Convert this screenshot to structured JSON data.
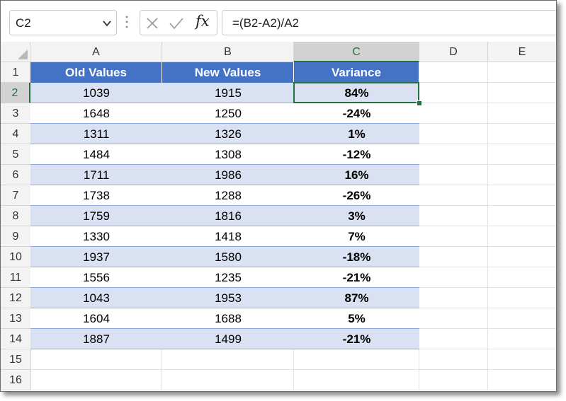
{
  "formula_bar": {
    "name_box": "C2",
    "formula": "=(B2-A2)/A2",
    "fx_label": "fx",
    "icons": [
      "chevron-down-icon",
      "grip-icon",
      "cancel-icon",
      "enter-icon",
      "function-icon"
    ]
  },
  "columns": [
    "A",
    "B",
    "C",
    "D",
    "E"
  ],
  "selected_column": "C",
  "selected_row": "2",
  "rows": [
    "1",
    "2",
    "3",
    "4",
    "5",
    "6",
    "7",
    "8",
    "9",
    "10",
    "11",
    "12",
    "13",
    "14",
    "15",
    "16"
  ],
  "table": {
    "headers": [
      "Old Values",
      "New Values",
      "Variance"
    ],
    "data": [
      [
        "1039",
        "1915",
        "84%"
      ],
      [
        "1648",
        "1250",
        "-24%"
      ],
      [
        "1311",
        "1326",
        "1%"
      ],
      [
        "1484",
        "1308",
        "-12%"
      ],
      [
        "1711",
        "1986",
        "16%"
      ],
      [
        "1738",
        "1288",
        "-26%"
      ],
      [
        "1759",
        "1816",
        "3%"
      ],
      [
        "1330",
        "1418",
        "7%"
      ],
      [
        "1937",
        "1580",
        "-18%"
      ],
      [
        "1556",
        "1235",
        "-21%"
      ],
      [
        "1043",
        "1953",
        "87%"
      ],
      [
        "1604",
        "1688",
        "5%"
      ],
      [
        "1887",
        "1499",
        "-21%"
      ]
    ]
  },
  "colors": {
    "header_fill": "#4472c4",
    "band_fill": "#d9e1f2",
    "selection": "#217346"
  }
}
